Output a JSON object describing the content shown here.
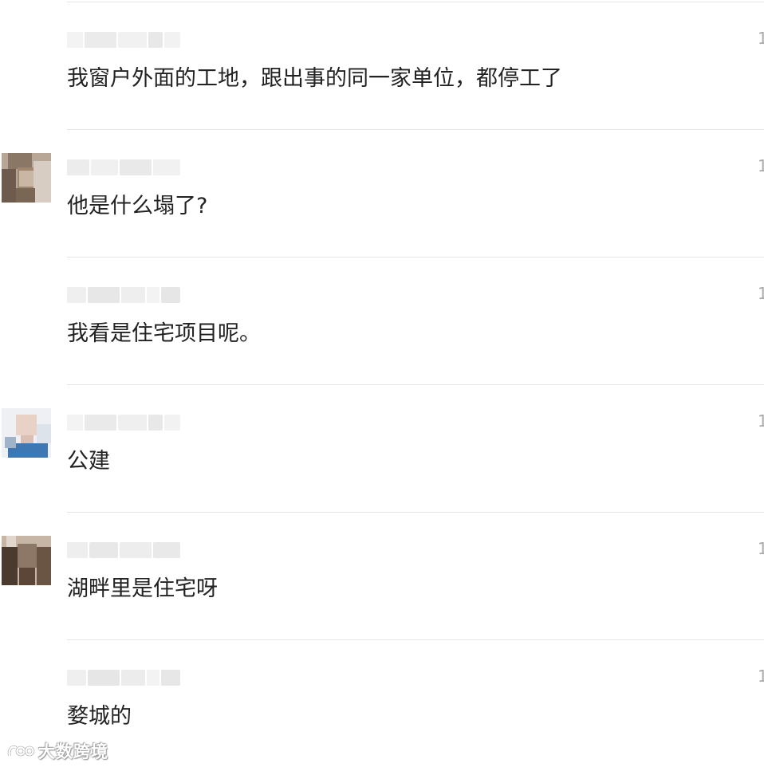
{
  "comments": [
    {
      "text": "我窗户外面的工地，跟出事的同一家单位，都停工了",
      "time": "1",
      "has_avatar": false
    },
    {
      "text": "他是什么塌了?",
      "time": "1",
      "has_avatar": true,
      "avatar_colors": [
        "#6d5b4e",
        "#a08870",
        "#c9b7a6",
        "#8a7462"
      ]
    },
    {
      "text": "我看是住宅项目呢。",
      "time": "1",
      "has_avatar": false
    },
    {
      "text": "公建",
      "time": "1",
      "has_avatar": true,
      "avatar_colors": [
        "#dde3ea",
        "#3e78b4",
        "#e8d2c6",
        "#9fb4c8"
      ]
    },
    {
      "text": "湖畔里是住宅呀",
      "time": "1",
      "has_avatar": true,
      "avatar_colors": [
        "#4b3a2e",
        "#8d7766",
        "#c7b6a5",
        "#6a5444"
      ]
    },
    {
      "text": "婺城的",
      "time": "1",
      "has_avatar": false
    }
  ],
  "watermark": {
    "text": "大数跨境"
  }
}
